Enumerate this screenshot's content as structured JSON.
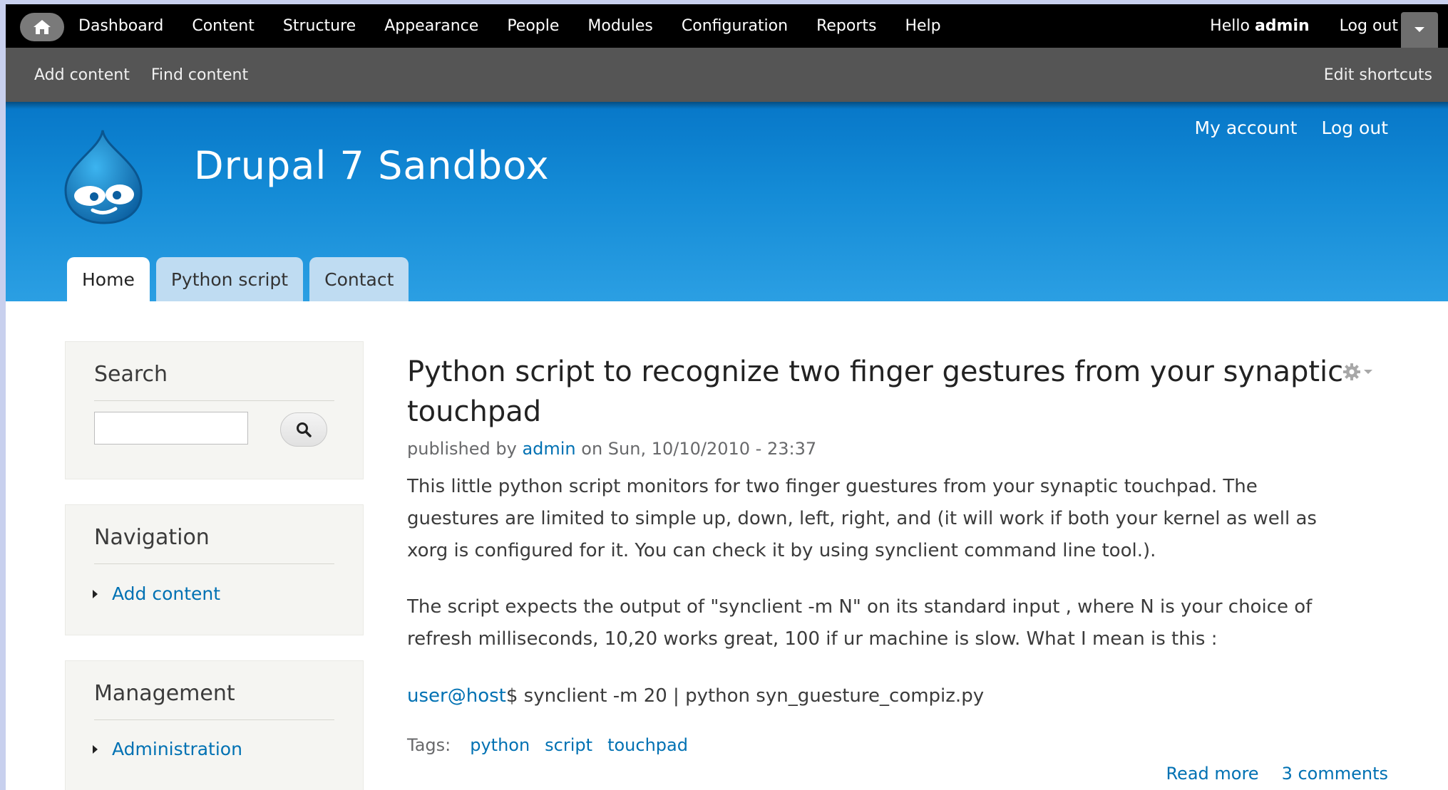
{
  "toolbar": {
    "menu": [
      "Dashboard",
      "Content",
      "Structure",
      "Appearance",
      "People",
      "Modules",
      "Configuration",
      "Reports",
      "Help"
    ],
    "hello_prefix": "Hello ",
    "user": "admin",
    "logout": "Log out"
  },
  "shortcuts": {
    "items": [
      "Add content",
      "Find content"
    ],
    "edit": "Edit shortcuts"
  },
  "header": {
    "site_name": "Drupal 7 Sandbox",
    "secondary_menu": [
      "My account",
      "Log out"
    ],
    "tabs": [
      "Home",
      "Python script",
      "Contact"
    ],
    "active_tab": "Home",
    "color": "#0779c9"
  },
  "sidebar": {
    "search": {
      "title": "Search",
      "value": ""
    },
    "navigation": {
      "title": "Navigation",
      "items": [
        "Add content"
      ]
    },
    "management": {
      "title": "Management",
      "items": [
        "Administration"
      ]
    }
  },
  "node": {
    "title_line1": "Python script to recognize two finger gestures from your synaptic",
    "title_line2": "touchpad",
    "submitted_prefix": "published by ",
    "author": "admin",
    "submitted_suffix": " on Sun, 10/10/2010 - 23:37",
    "para1": [
      "This little python script monitors for two finger guestures from your synaptic touchpad. The",
      "guestures are limited to simple up, down, left, right, and (it will work if both your kernel as well as",
      "xorg is configured for it. You can check it by using synclient command line tool.)."
    ],
    "para2": [
      "The script expects the output of \"synclient -m N\" on its standard input , where N is your choice of",
      "refresh milliseconds, 10,20 works great, 100 if ur machine is slow. What I mean is this :"
    ],
    "command_link": "user@host",
    "command_rest": "$ synclient -m 20 | python syn_guesture_compiz.py",
    "tags_label": "Tags:",
    "tags": [
      "python",
      "script",
      "touchpad"
    ],
    "links": [
      "Read more",
      "3 comments"
    ]
  }
}
